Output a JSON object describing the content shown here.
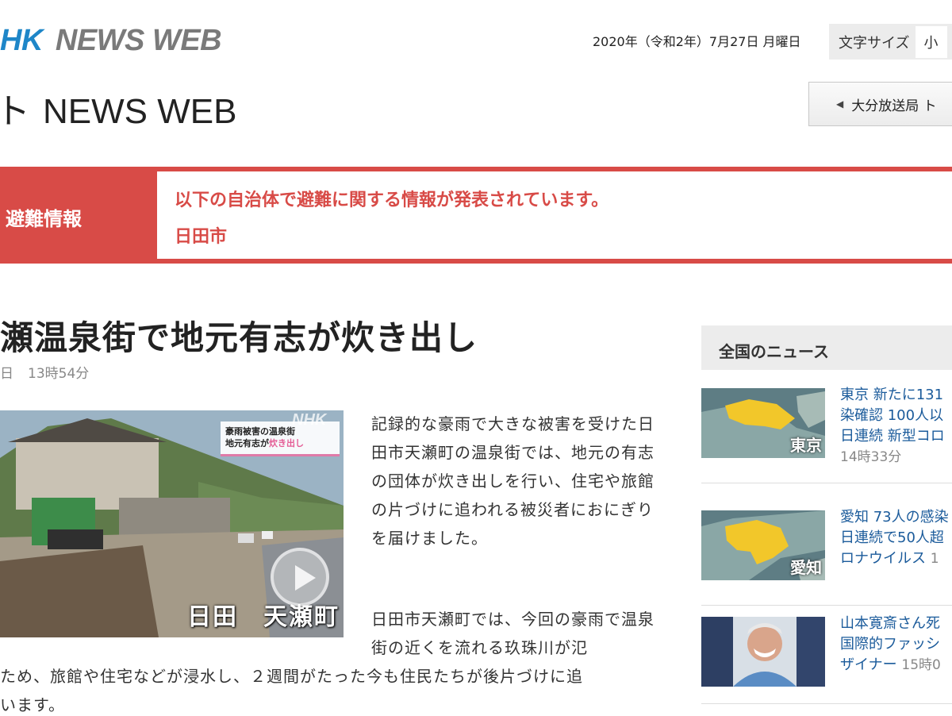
{
  "header": {
    "logo_nhk": "HK",
    "logo_newsweb": "NEWS WEB",
    "date": "2020年（令和2年）7月27日 月曜日",
    "font_size_label": "文字サイズ",
    "font_size_small": "小"
  },
  "station": {
    "title_mark": "ト",
    "title": "NEWS WEB",
    "nav_button": "大分放送局 ト"
  },
  "evacuation": {
    "label": "避難情報",
    "headline": "以下の自治体で避難に関する情報が発表されています。",
    "city": "日田市"
  },
  "article": {
    "title": "瀬温泉街で地元有志が炊き出し",
    "date_fragment": "日",
    "time": "13時54分",
    "video_caption_line1": "豪雨被害の温泉街",
    "video_caption_line2a": "地元有志が",
    "video_caption_line2b": "炊き出し",
    "video_watermark": "NHK",
    "video_location": "日田　天瀬町",
    "para1": "記録的な豪雨で大きな被害を受けた日田市天瀬町の温泉街では、地元の有志の団体が炊き出しを行い、住宅や旅館の片づけに追われる被災者におにぎりを届けました。",
    "para2a": "日田市天瀬町では、今回の豪雨で温泉街の近くを流れる玖珠川が氾",
    "para2b": "ため、旅館や住宅などが浸水し、２週間がたった今も住民たちが後片づけに追\nいます。"
  },
  "sidebar": {
    "heading": "全国のニュース",
    "items": [
      {
        "text": "東京 新たに131\n染確認 100人以\n日連続 新型コロ",
        "time": "14時33分",
        "thumb_label": "東京"
      },
      {
        "text": "愛知 73人の感染\n日連続で50人超\nロナウイルス",
        "time": "1",
        "thumb_label": "愛知"
      },
      {
        "text": "山本寛斎さん死\n国際的ファッシ\nザイナー",
        "time": "15時0"
      }
    ]
  },
  "colors": {
    "accent_red": "#d84b47",
    "nhk_blue": "#1e86c8",
    "link_blue": "#1b5b9b"
  }
}
